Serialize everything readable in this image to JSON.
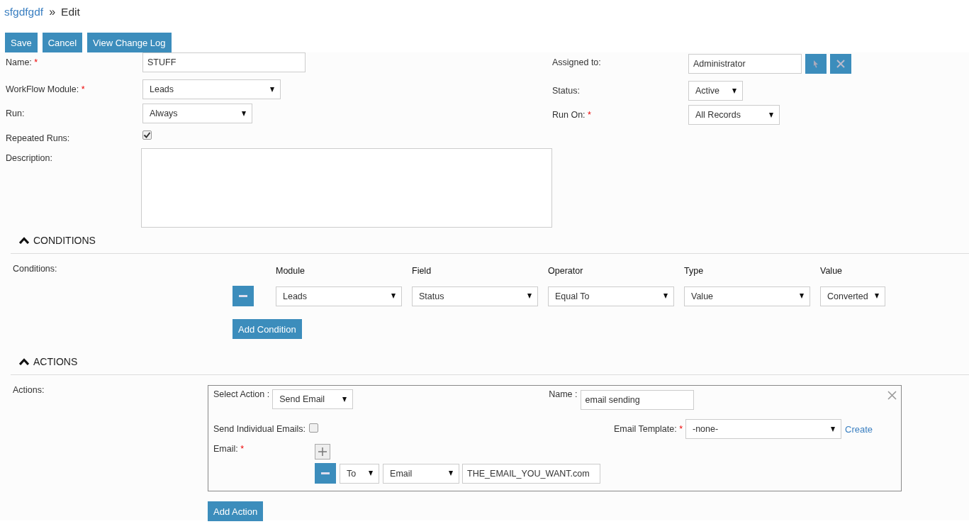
{
  "breadcrumb": {
    "link": "sfgdfgdf",
    "separator": "»",
    "current": "Edit"
  },
  "toolbar": [
    "Save",
    "Cancel",
    "View Change Log"
  ],
  "form": {
    "left": [
      {
        "label": "Name:",
        "required_mark": "*",
        "kind": "text",
        "value": "STUFF"
      },
      {
        "label": "WorkFlow Module:",
        "required_mark": "*",
        "kind": "select",
        "value": "Leads"
      },
      {
        "label": "Run:",
        "kind": "select",
        "value": "Always"
      },
      {
        "label": "Repeated Runs:",
        "kind": "checkbox",
        "checked": true
      },
      {
        "label": "Description:",
        "kind": "textarea"
      }
    ],
    "right": [
      {
        "label": "Assigned to:",
        "kind": "user",
        "value": "Administrator"
      },
      {
        "label": "Status:",
        "kind": "select",
        "value": "Active"
      },
      {
        "label": "Run On:",
        "required_mark": "*",
        "kind": "select",
        "value": "All Records"
      }
    ]
  },
  "conditions": {
    "title": "CONDITIONS",
    "label": "Conditions:",
    "columns": [
      "Module",
      "Field",
      "Operator",
      "Type",
      "Value"
    ],
    "rows": [
      [
        "Leads",
        "Status",
        "Equal To",
        "Value",
        "Converted"
      ]
    ],
    "add_button": "Add Condition"
  },
  "actions": {
    "title": "ACTIONS",
    "label": "Actions:",
    "items": [
      {
        "select_label": "Select Action :",
        "action": "Send Email",
        "name_label": "Name :",
        "name": "email sending",
        "individual_label": "Send Individual Emails:",
        "individual_checked": false,
        "template_label": "Email Template:",
        "template_mark": "*",
        "template": "-none-",
        "create_link": "Create",
        "email_label": "Email:",
        "email_mark": "*",
        "recipients": [
          {
            "type": "To",
            "field": "Email",
            "value": "THE_EMAIL_YOU_WANT.com"
          }
        ]
      }
    ],
    "add_button": "Add Action"
  }
}
